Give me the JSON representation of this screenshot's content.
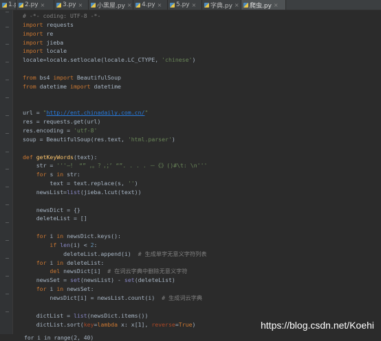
{
  "tabs": [
    {
      "label": "1.py",
      "active": false
    },
    {
      "label": "2.py",
      "active": false
    },
    {
      "label": "3.py",
      "active": false
    },
    {
      "label": "小黑屋.py",
      "active": false
    },
    {
      "label": "4.py",
      "active": false
    },
    {
      "label": "5.py",
      "active": false
    },
    {
      "label": "字典.py",
      "active": false
    },
    {
      "label": "爬虫.py",
      "active": true
    }
  ],
  "code": [
    [
      [
        "cm",
        "# -*- coding: UTF-8 -*-"
      ]
    ],
    [
      [
        "kw",
        "import"
      ],
      [
        "",
        " requests"
      ]
    ],
    [
      [
        "kw",
        "import"
      ],
      [
        "",
        " re"
      ]
    ],
    [
      [
        "kw",
        "import"
      ],
      [
        "",
        " jieba"
      ]
    ],
    [
      [
        "kw",
        "import"
      ],
      [
        "",
        " locale"
      ]
    ],
    [
      [
        "",
        "locale=locale.setlocale(locale.LC_CTYPE, "
      ],
      [
        "str",
        "'chinese'"
      ],
      [
        "",
        ")"
      ]
    ],
    [],
    [
      [
        "kw",
        "from"
      ],
      [
        "",
        " bs4 "
      ],
      [
        "kw",
        "import"
      ],
      [
        "",
        " BeautifulSoup"
      ]
    ],
    [
      [
        "kw",
        "from"
      ],
      [
        "",
        " datetime "
      ],
      [
        "kw",
        "import"
      ],
      [
        "",
        " datetime"
      ]
    ],
    [],
    [],
    [
      [
        "",
        "url = "
      ],
      [
        "str",
        "\""
      ],
      [
        "url",
        "http://ent.chinadaily.com.cn/"
      ],
      [
        "str",
        "\""
      ]
    ],
    [
      [
        "",
        "res = requests.get(url)"
      ]
    ],
    [
      [
        "",
        "res.encoding = "
      ],
      [
        "str",
        "'utf-8'"
      ]
    ],
    [
      [
        "",
        "soup = BeautifulSoup(res.text, "
      ],
      [
        "str",
        "'html.parser'"
      ],
      [
        "",
        ")"
      ]
    ],
    [],
    [
      [
        "kw",
        "def "
      ],
      [
        "fn",
        "getKeyWords"
      ],
      [
        "",
        "(text):"
      ]
    ],
    [
      [
        "",
        "    str = "
      ],
      [
        "str",
        "'''—！ “” ，。？，；’ “”. . . . －《》()#\\t: \\n'''"
      ]
    ],
    [
      [
        "kw",
        "    for"
      ],
      [
        "",
        " s "
      ],
      [
        "kw",
        "in"
      ],
      [
        "",
        " str:"
      ]
    ],
    [
      [
        "",
        "        text = text.replace(s, "
      ],
      [
        "str",
        "''"
      ],
      [
        "",
        ")"
      ]
    ],
    [
      [
        "",
        "    newsList="
      ],
      [
        "bi",
        "list"
      ],
      [
        "",
        "(jieba.lcut(text))"
      ]
    ],
    [],
    [
      [
        "",
        "    newsDict = {}"
      ]
    ],
    [
      [
        "",
        "    deleteList = []"
      ]
    ],
    [],
    [
      [
        "kw",
        "    for"
      ],
      [
        "",
        " i "
      ],
      [
        "kw",
        "in"
      ],
      [
        "",
        " newsDict.keys():"
      ]
    ],
    [
      [
        "kw",
        "        if "
      ],
      [
        "bi",
        "len"
      ],
      [
        "",
        "(i) < "
      ],
      [
        "num",
        "2"
      ],
      [
        "",
        ":"
      ]
    ],
    [
      [
        "",
        "            deleteList.append(i)  "
      ],
      [
        "cm",
        "# 生成单字无意义字符列表"
      ]
    ],
    [
      [
        "kw",
        "    for"
      ],
      [
        "",
        " i "
      ],
      [
        "kw",
        "in"
      ],
      [
        "",
        " deleteList:"
      ]
    ],
    [
      [
        "kw",
        "        del"
      ],
      [
        "",
        " newsDict[i]  "
      ],
      [
        "cm",
        "# 在词云字典中删除无意义字符"
      ]
    ],
    [
      [
        "",
        "    newsSet = "
      ],
      [
        "bi",
        "set"
      ],
      [
        "",
        "(newsList) - "
      ],
      [
        "bi",
        "set"
      ],
      [
        "",
        "(deleteList)"
      ]
    ],
    [
      [
        "kw",
        "    for"
      ],
      [
        "",
        " i "
      ],
      [
        "kw",
        "in"
      ],
      [
        "",
        " newsSet:"
      ]
    ],
    [
      [
        "",
        "        newsDict[i] = newsList.count(i)  "
      ],
      [
        "cm",
        "# 生成词云字典"
      ]
    ],
    [],
    [
      [
        "",
        "    dictList = "
      ],
      [
        "bi",
        "list"
      ],
      [
        "",
        "(newsDict.items())"
      ]
    ],
    [
      [
        "",
        "    dictList.sort("
      ],
      [
        "kwarg",
        "key"
      ],
      [
        "",
        "="
      ],
      [
        "kw",
        "lambda"
      ],
      [
        "",
        " x: x[1], "
      ],
      [
        "kwarg",
        "reverse"
      ],
      [
        "",
        "="
      ],
      [
        "kw",
        "True"
      ],
      [
        "",
        ")"
      ]
    ]
  ],
  "bottom_line": "for i in range(2, 40)",
  "watermark": "https://blog.csdn.net/Koehi"
}
